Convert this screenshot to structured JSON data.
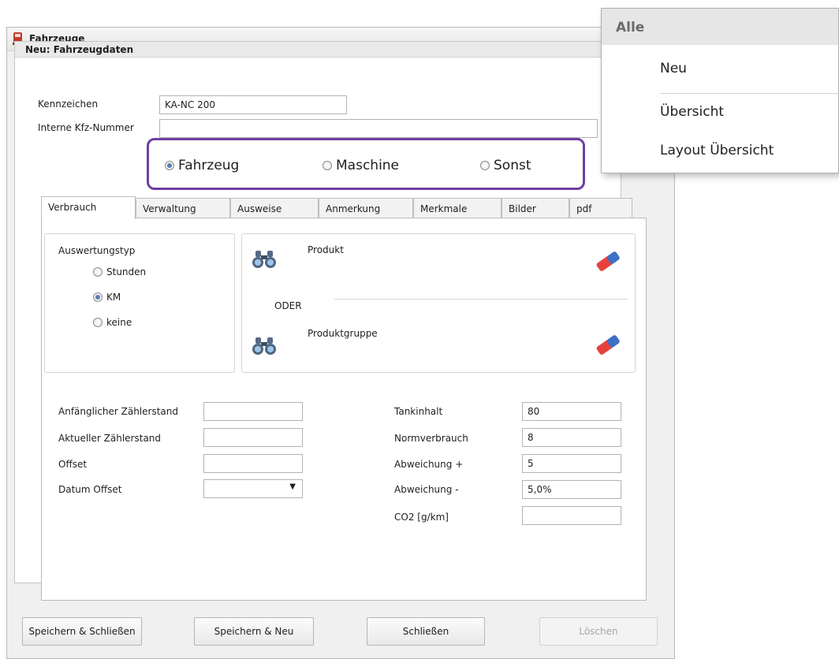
{
  "window": {
    "title": "Fahrzeuge"
  },
  "group": {
    "title": "Neu: Fahrzeugdaten"
  },
  "fields": {
    "kennzeichen_label": "Kennzeichen",
    "kennzeichen_value": "KA-NC 200",
    "interne_label": "Interne Kfz-Nummer",
    "interne_value": ""
  },
  "type_options": {
    "fahrzeug": "Fahrzeug",
    "maschine": "Maschine",
    "sonst": "Sonst",
    "selected": "Fahrzeug"
  },
  "tabs": [
    {
      "label": "Verbrauch",
      "active": true
    },
    {
      "label": "Verwaltung"
    },
    {
      "label": "Ausweise"
    },
    {
      "label": "Anmerkung"
    },
    {
      "label": "Merkmale"
    },
    {
      "label": "Bilder"
    },
    {
      "label": "pdf"
    }
  ],
  "auswertung": {
    "title": "Auswertungstyp",
    "options": [
      "Stunden",
      "KM",
      "keine"
    ],
    "selected": "KM"
  },
  "product": {
    "produkt_label": "Produkt",
    "oder_label": "ODER",
    "produktgruppe_label": "Produktgruppe"
  },
  "left_fields": {
    "anf_label": "Anfänglicher Zählerstand",
    "anf_value": "",
    "akt_label": "Aktueller Zählerstand",
    "akt_value": "",
    "offset_label": "Offset",
    "offset_value": "",
    "datum_label": "Datum Offset",
    "datum_value": ""
  },
  "right_fields": {
    "tank_label": "Tankinhalt",
    "tank_value": "80",
    "norm_label": "Normverbrauch",
    "norm_value": "8",
    "abw_plus_label": "Abweichung +",
    "abw_plus_value": "5",
    "abw_minus_label": "Abweichung -",
    "abw_minus_value": "5,0%",
    "co2_label": "CO2 [g/km]",
    "co2_value": ""
  },
  "buttons": {
    "save_close": "Speichern & Schließen",
    "save_new": "Speichern & Neu",
    "close": "Schließen",
    "delete": "Löschen"
  },
  "context_menu": {
    "header": "Alle",
    "items": [
      "Neu",
      "Übersicht",
      "Layout Übersicht"
    ]
  },
  "colors": {
    "highlight_border": "#6e3fa0",
    "radio_dot": "#5a7fb5"
  }
}
